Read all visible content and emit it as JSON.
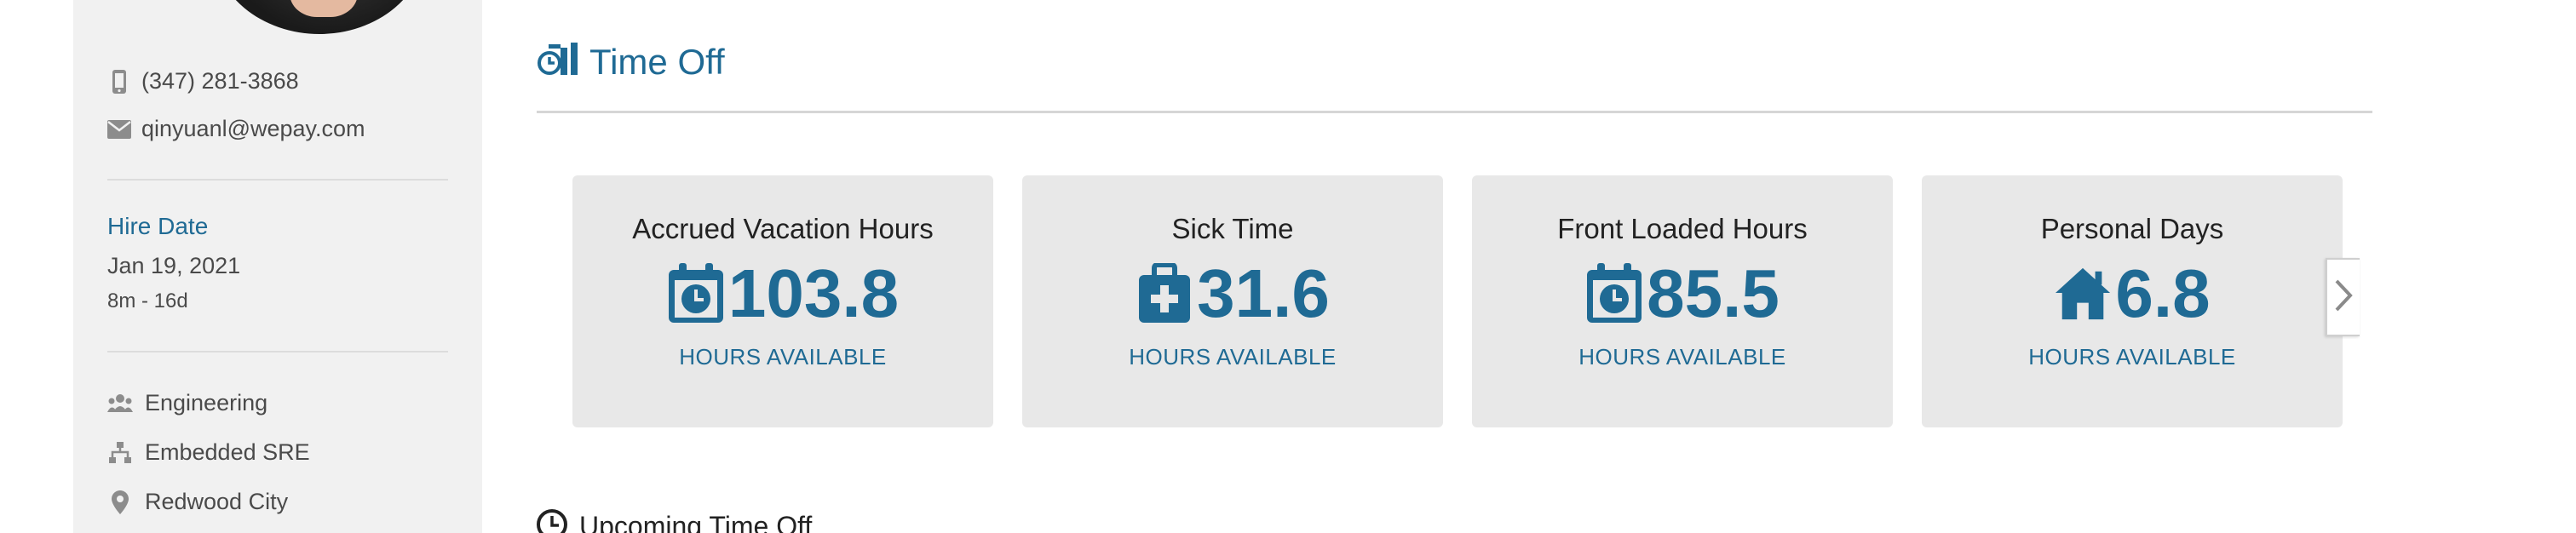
{
  "sidebar": {
    "phone": "(347) 281-3868",
    "email": "qinyuanl@wepay.com",
    "hire_date_label": "Hire Date",
    "hire_date": "Jan 19, 2021",
    "tenure": "8m - 16d",
    "department": "Engineering",
    "team": "Embedded SRE",
    "location": "Redwood City",
    "icons": {
      "phone": "phone-icon",
      "email": "envelope-icon",
      "department": "people-icon",
      "team": "org-chart-icon",
      "location": "map-pin-icon"
    }
  },
  "time_off": {
    "title": "Time Off",
    "icon": "time-off-icon",
    "cards": [
      {
        "title": "Accrued Vacation Hours",
        "value": "103.8",
        "sub": "HOURS AVAILABLE",
        "icon": "calendar-clock-icon"
      },
      {
        "title": "Sick Time",
        "value": "31.6",
        "sub": "HOURS AVAILABLE",
        "icon": "medical-bag-icon"
      },
      {
        "title": "Front Loaded Hours",
        "value": "85.5",
        "sub": "HOURS AVAILABLE",
        "icon": "calendar-clock-icon"
      },
      {
        "title": "Personal Days",
        "value": "6.8",
        "sub": "HOURS AVAILABLE",
        "icon": "house-icon"
      }
    ],
    "next_icon": "chevron-right-icon"
  },
  "upcoming": {
    "label": "Upcoming Time Off",
    "icon": "clock-icon"
  },
  "colors": {
    "accent": "#1f6a94",
    "sidebar_bg": "#f1f1f1",
    "card_bg": "#e8e8e8"
  }
}
